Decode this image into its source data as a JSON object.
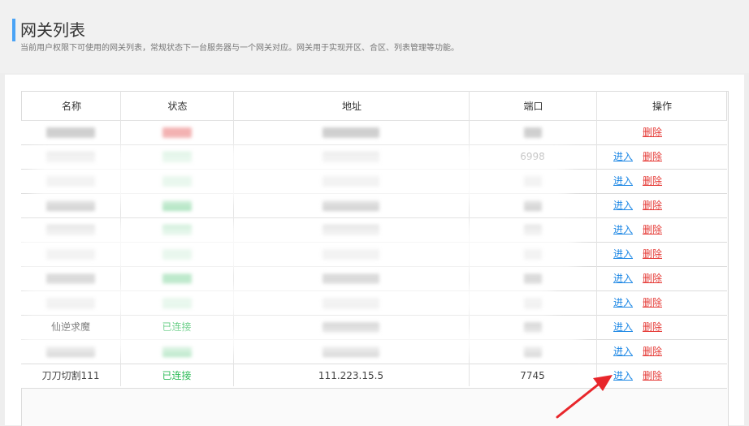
{
  "header": {
    "title": "网关列表",
    "subtitle": "当前用户权限下可使用的网关列表，常规状态下一台服务器与一个网关对应。网关用于实现开区、合区、列表管理等功能。"
  },
  "table": {
    "columns": [
      "名称",
      "状态",
      "地址",
      "端口",
      "操作"
    ],
    "rows": [
      {
        "name": "",
        "status": "",
        "address": "",
        "port": "",
        "enter": "",
        "delete": "删除"
      },
      {
        "name": "",
        "status": "",
        "address": "",
        "port": "6998",
        "enter": "进入",
        "delete": "删除"
      },
      {
        "name": "",
        "status": "",
        "address": "",
        "port": "",
        "enter": "进入",
        "delete": "删除"
      },
      {
        "name": "",
        "status": "",
        "address": "",
        "port": "",
        "enter": "进入",
        "delete": "删除"
      },
      {
        "name": "",
        "status": "",
        "address": "",
        "port": "",
        "enter": "进入",
        "delete": "删除"
      },
      {
        "name": "",
        "status": "",
        "address": "",
        "port": "",
        "enter": "进入",
        "delete": "删除"
      },
      {
        "name": "",
        "status": "",
        "address": "",
        "port": "",
        "enter": "进入",
        "delete": "删除"
      },
      {
        "name": "",
        "status": "",
        "address": "",
        "port": "",
        "enter": "进入",
        "delete": "删除"
      },
      {
        "name": "仙逆求魔",
        "status": "已连接",
        "address": "",
        "port": "",
        "enter": "进入",
        "delete": "删除"
      },
      {
        "name": "",
        "status": "",
        "address": "",
        "port": "",
        "enter": "进入",
        "delete": "删除"
      },
      {
        "name": "刀刀切割111",
        "status": "已连接",
        "address": "111.223.15.5",
        "port": "7745",
        "enter": "进入",
        "delete": "删除"
      }
    ]
  },
  "colors": {
    "accent": "#4aa3f5",
    "status_ok": "#2dbb57",
    "link": "#1e88e5",
    "danger": "#e53935",
    "annotation_arrow": "#e8262b"
  }
}
